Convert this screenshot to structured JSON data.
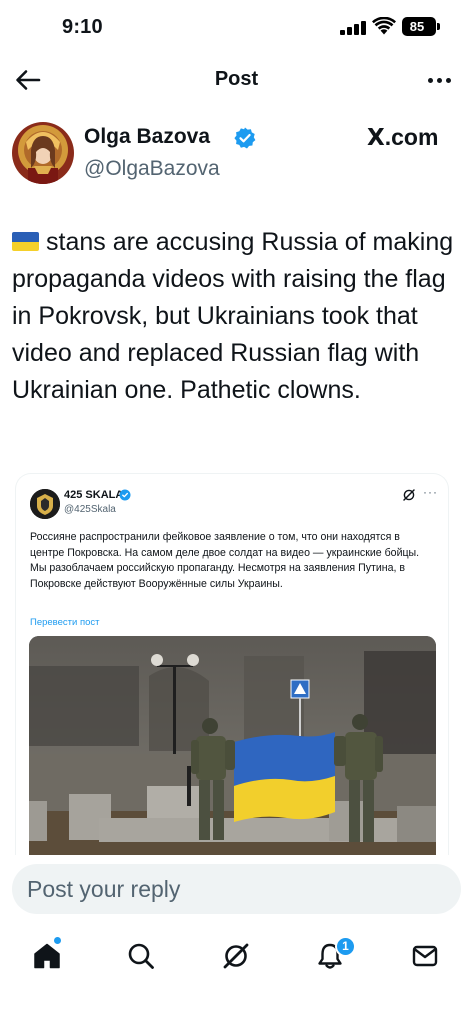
{
  "status_bar": {
    "time": "9:10",
    "battery": "85"
  },
  "header": {
    "title": "Post",
    "back_icon": "arrow-left-icon",
    "more_icon": "more-horizontal-icon"
  },
  "author": {
    "name": "Olga Bazova",
    "handle": "@OlgaBazova",
    "verified": true,
    "source": ".com",
    "source_mark": "X"
  },
  "tweet": {
    "text": "stans are accusing Russia of making propaganda videos with raising the flag in Pokrovsk, but Ukrainians took that video and replaced Russian flag with Ukrainian one. Pathetic clowns."
  },
  "quoted_post": {
    "name": "425 SKALA",
    "handle": "@425Skala",
    "text": "Россияне распространили фейковое заявление о том, что они находятся в центре Покровска. На самом деле двое солдат на видео — украинские бойцы. Мы разоблачаем российскую пропаганду. Несмотря на заявления Путина, в Покровске действуют Вооружённые силы Украины.",
    "translate": "Перевести пост",
    "more": "···"
  },
  "reply": {
    "placeholder": "Post your reply"
  },
  "nav": {
    "items": [
      "home-icon",
      "search-icon",
      "grok-icon",
      "notifications-icon",
      "messages-icon"
    ],
    "notification_count": "1"
  },
  "colors": {
    "accent": "#1d9bf0",
    "text": "#0f1419",
    "secondary": "#536471",
    "flag_blue": "#2a5fb6",
    "flag_yellow": "#f5d02a"
  }
}
